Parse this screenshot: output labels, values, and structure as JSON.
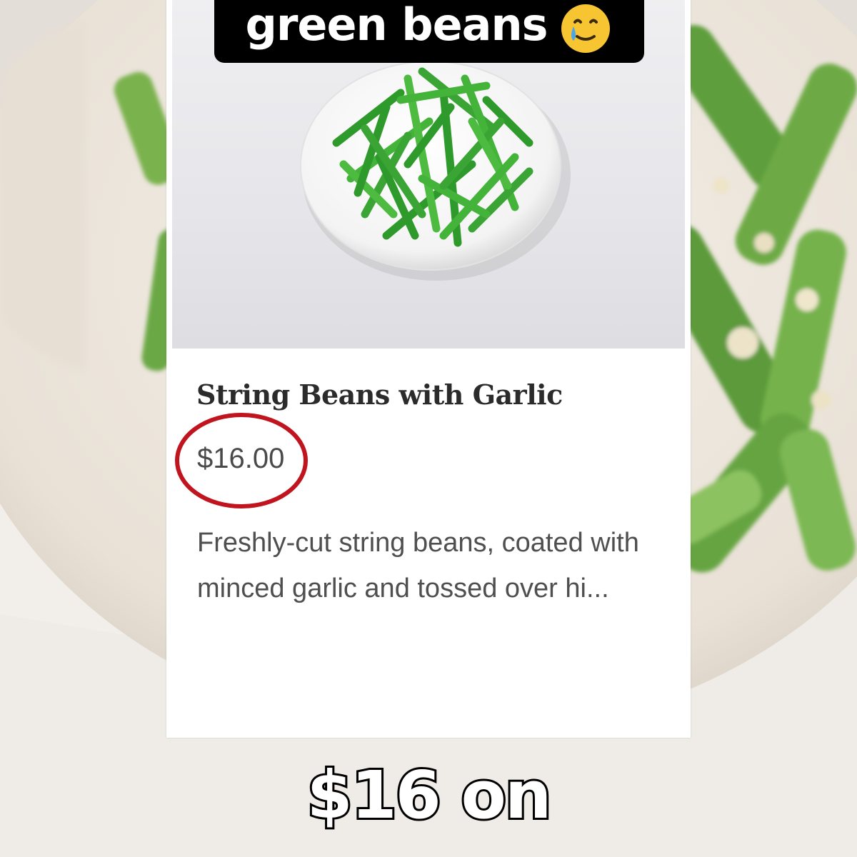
{
  "overlay": {
    "top_caption": "green beans",
    "top_caption_emoji": "face-holding-back-tears-icon",
    "bottom_caption": "$16 on"
  },
  "menu_item": {
    "name": "String Beans with Garlic",
    "price": "$16.00",
    "description": "Freshly-cut string beans, coated with minced garlic and tossed over hi..."
  },
  "colors": {
    "highlight_circle": "#c0141e",
    "bean_green": "#3fae3a",
    "caption_bg": "#000000"
  }
}
